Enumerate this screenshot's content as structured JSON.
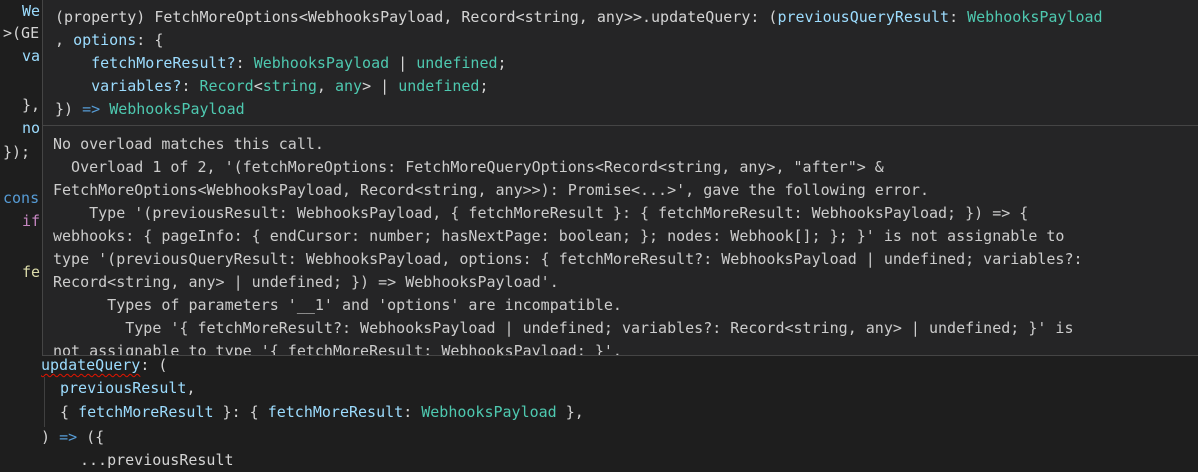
{
  "editor": {
    "left_fragments": [
      {
        "text": "We",
        "color": "#9cdcfe"
      },
      {
        "text": ">(GE",
        "color": "#d4d4d4"
      },
      {
        "text": "va",
        "color": "#9cdcfe"
      },
      {
        "text": "},",
        "color": "#d4d4d4"
      },
      {
        "text": "no",
        "color": "#9cdcfe"
      },
      {
        "text": "});",
        "color": "#d4d4d4"
      },
      {
        "text": "cons",
        "color": "#569cd6"
      },
      {
        "text": "if",
        "color": "#c586c0"
      },
      {
        "text": "fe",
        "color": "#dcdcaa"
      }
    ],
    "code": {
      "update_query": "updateQuery",
      "colon_paren": ": (",
      "previous_result": "previousResult",
      "comma": ",",
      "open_brace": "{ ",
      "fetch_more_result": "fetchMoreResult",
      "close_brace_colon": " }: { ",
      "fetch_more_result_2": "fetchMoreResult",
      "colon_space": ": ",
      "webhooks_payload": "WebhooksPayload",
      "close_brace_comma": " },",
      "close_paren": ") ",
      "arrow": "=>",
      "open_obj": " ({",
      "partial_line": "...previousResult"
    }
  },
  "hover": {
    "signature": {
      "l1_a": "(property) FetchMoreOptions<WebhooksPayload, Record<string, any>>.updateQuery: (",
      "l1_b": "previousQueryResult",
      "l1_c": ": ",
      "l1_d": "WebhooksPayload",
      "l2_a": ", ",
      "l2_b": "options",
      "l2_c": ": {",
      "l3_a": "    ",
      "l3_b": "fetchMoreResult?",
      "l3_c": ": ",
      "l3_d": "WebhooksPayload",
      "l3_e": " | ",
      "l3_f": "undefined",
      "l3_g": ";",
      "l4_a": "    ",
      "l4_b": "variables?",
      "l4_c": ": ",
      "l4_d": "Record",
      "l4_e": "<",
      "l4_f": "string",
      "l4_g": ", ",
      "l4_h": "any",
      "l4_i": "> | ",
      "l4_j": "undefined",
      "l4_k": ";",
      "l5_a": "}) ",
      "l5_b": "=>",
      "l5_c": " ",
      "l5_d": "WebhooksPayload"
    },
    "message_lines": [
      "No overload matches this call.",
      "  Overload 1 of 2, '(fetchMoreOptions: FetchMoreQueryOptions<Record<string, any>, \"after\"> &",
      "FetchMoreOptions<WebhooksPayload, Record<string, any>>): Promise<...>', gave the following error.",
      "    Type '(previousResult: WebhooksPayload, { fetchMoreResult }: { fetchMoreResult: WebhooksPayload; }) => {",
      "webhooks: { pageInfo: { endCursor: number; hasNextPage: boolean; }; nodes: Webhook[]; }; }' is not assignable to",
      "type '(previousQueryResult: WebhooksPayload, options: { fetchMoreResult?: WebhooksPayload | undefined; variables?:",
      "Record<string, any> | undefined; }) => WebhooksPayload'.",
      "      Types of parameters '__1' and 'options' are incompatible.",
      "        Type '{ fetchMoreResult?: WebhooksPayload | undefined; variables?: Record<string, any> | undefined; }' is",
      "not assignable to type '{ fetchMoreResult: WebhooksPayload; }'."
    ]
  }
}
